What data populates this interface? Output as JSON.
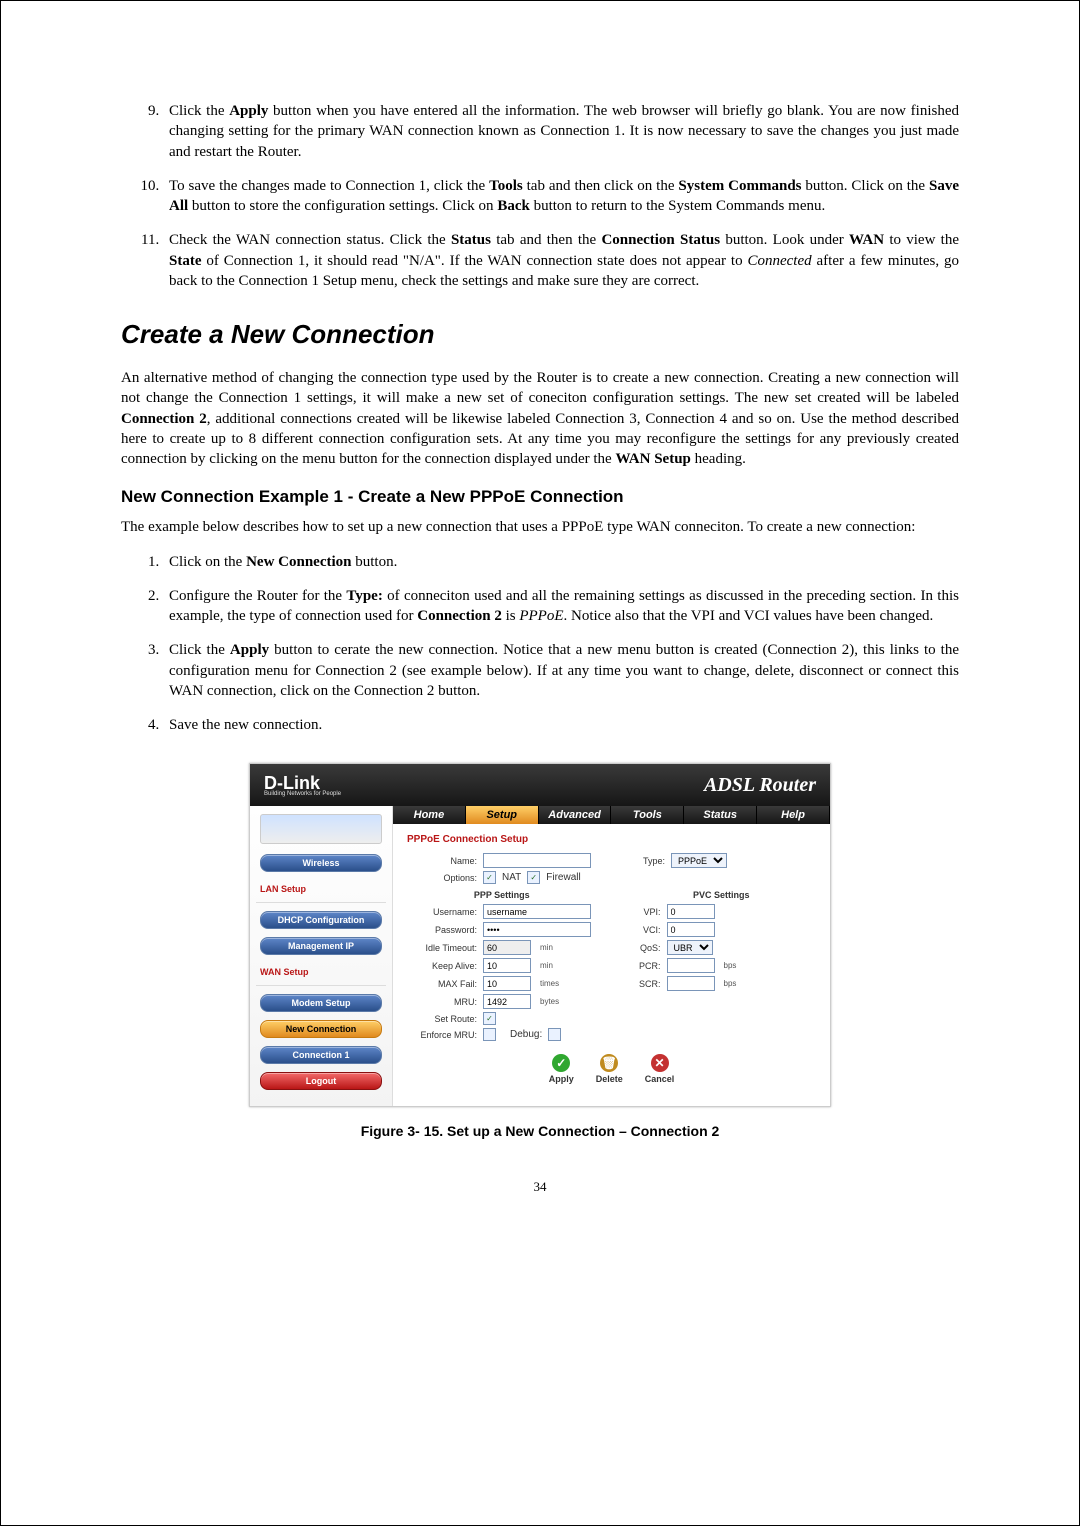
{
  "steps_a_start": 9,
  "steps_a": [
    {
      "pre": "Click the ",
      "b1": "Apply",
      "post1": " button when you have entered all the information. The web browser will briefly go blank. You are now finished changing setting for the primary WAN connection known as Connection 1. It is now necessary to save the changes you just made and restart the Router."
    },
    {
      "pre": "To save the changes made to Connection 1, click the ",
      "b1": "Tools",
      "mid1": " tab and then click on the ",
      "b2": "System Commands",
      "mid2": " button. Click on the ",
      "b3": "Save All",
      "mid3": " button to store the configuration settings. Click on ",
      "b4": "Back",
      "post": " button to return to the System Commands menu."
    },
    {
      "pre": "Check the WAN connection status. Click the ",
      "b1": "Status",
      "mid1": " tab and then the ",
      "b2": "Connection Status",
      "mid2": " button. Look under ",
      "b3": "WAN",
      "mid3": " to view the ",
      "b4": "State",
      "mid4": " of Connection 1, it should read \"N/A\". If the WAN connection state does not appear to ",
      "i1": "Connected",
      "post": " after a few minutes, go back to the Connection 1 Setup menu, check the settings and make sure they are correct."
    }
  ],
  "h1": "Create a New Connection",
  "p1a": "An alternative method of changing the connection type used by the Router is to create a new connection. Creating a new connection will not change the Connection 1 settings, it will make a new set of coneciton configuration settings. The new set created will be labeled ",
  "p1b": "Connection 2",
  "p1c": ", additional connections created will be likewise labeled Connection 3, Connection 4 and so on. Use the method described here to create up to 8 different connection configuration sets. At any time you may reconfigure the settings for any previously created connection by clicking on the menu button for the connection displayed under the ",
  "p1d": "WAN Setup",
  "p1e": " heading.",
  "h2": "New Connection Example 1 - Create a New PPPoE Connection",
  "p2": "The example below describes how to set up a new connection that uses a PPPoE type WAN conneciton. To create a new connection:",
  "steps_b": [
    {
      "pre": "Click on the ",
      "b1": "New Connection",
      "post": " button."
    },
    {
      "pre": "Configure the Router for the ",
      "b1": "Type:",
      "mid1": " of conneciton used and all the remaining settings as discussed in the preceding section. In this example, the type of connection used for ",
      "b2": "Connection 2",
      "mid2": " is ",
      "i1": "PPPoE",
      "post": ". Notice also that the VPI and VCI values have been changed."
    },
    {
      "pre": "Click the ",
      "b1": "Apply",
      "post": "  button to cerate the new connection. Notice that a new menu button is created (Connection 2), this links to the configuration menu for Connection 2 (see example below). If at any time you want to change, delete, disconnect or connect this WAN connection, click on the Connection 2 button."
    },
    {
      "pre": "Save the new connection.",
      "b1": "",
      "post": ""
    }
  ],
  "router": {
    "logo": "D-Link",
    "logo_sub": "Building Networks for People",
    "title": "ADSL Router",
    "tabs": [
      "Home",
      "Setup",
      "Advanced",
      "Tools",
      "Status",
      "Help"
    ],
    "tab_selected": 1,
    "side": {
      "wireless": "Wireless",
      "lan": "LAN Setup",
      "dhcp": "DHCP Configuration",
      "mgmt": "Management IP",
      "wan": "WAN Setup",
      "modem": "Modem Setup",
      "newconn": "New Connection",
      "conn1": "Connection 1",
      "logout": "Logout"
    },
    "pane_title": "PPPoE Connection Setup",
    "name_lbl": "Name:",
    "name_val": "",
    "type_lbl": "Type:",
    "type_val": "PPPoE",
    "opts_lbl": "Options:",
    "nat": "NAT",
    "fw": "Firewall",
    "ppp_title": "PPP Settings",
    "pvc_title": "PVC Settings",
    "ppp": {
      "user_l": "Username:",
      "user_v": "username",
      "pass_l": "Password:",
      "pass_v": "••••",
      "idle_l": "Idle Timeout:",
      "idle_v": "60",
      "idle_u": "min",
      "keep_l": "Keep Alive:",
      "keep_v": "10",
      "keep_u": "min",
      "maxf_l": "MAX Fail:",
      "maxf_v": "10",
      "maxf_u": "times",
      "mru_l": "MRU:",
      "mru_v": "1492",
      "mru_u": "bytes",
      "sr_l": "Set Route:",
      "emru_l": "Enforce MRU:",
      "dbg_l": "Debug:"
    },
    "pvc": {
      "vpi_l": "VPI:",
      "vpi_v": "0",
      "vci_l": "VCI:",
      "vci_v": "0",
      "qos_l": "QoS:",
      "qos_v": "UBR",
      "pcr_l": "PCR:",
      "pcr_u": "bps",
      "scr_l": "SCR:",
      "scr_u": "bps"
    },
    "actions": {
      "apply": "Apply",
      "delete": "Delete",
      "cancel": "Cancel"
    }
  },
  "figcap": "Figure 3- 15. Set up a New Connection – Connection 2",
  "pagenum": "34"
}
